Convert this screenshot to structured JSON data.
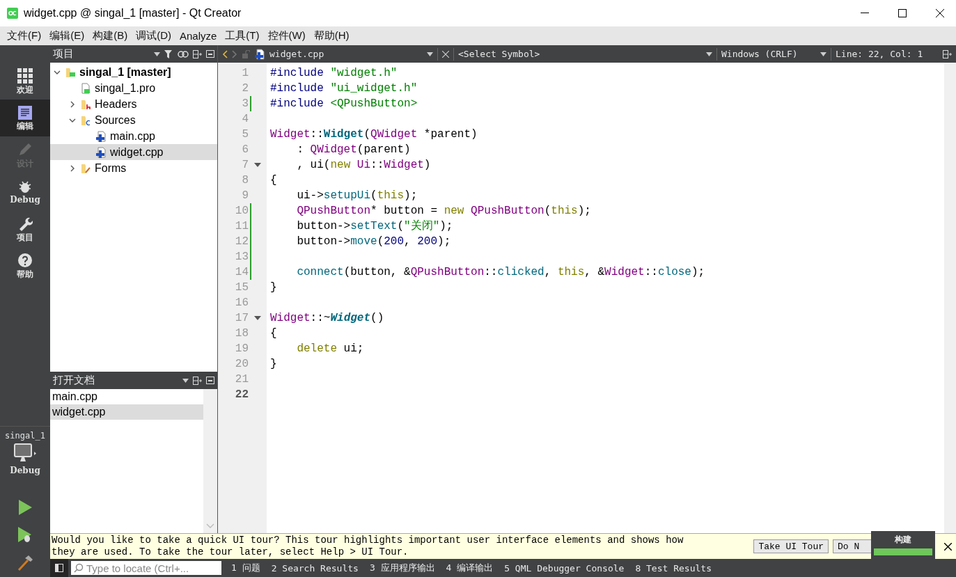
{
  "window": {
    "title": "widget.cpp @ singal_1 [master] - Qt Creator"
  },
  "menu": [
    "文件(F)",
    "编辑(E)",
    "构建(B)",
    "调试(D)",
    "Analyze",
    "工具(T)",
    "控件(W)",
    "帮助(H)"
  ],
  "modes": [
    {
      "label": "欢迎",
      "kind": "grid",
      "selected": false,
      "disabled": false
    },
    {
      "label": "编辑",
      "kind": "edit",
      "selected": true,
      "disabled": false
    },
    {
      "label": "设计",
      "kind": "pencil",
      "selected": false,
      "disabled": true
    },
    {
      "label": "Debug",
      "kind": "bug",
      "selected": false,
      "disabled": false
    },
    {
      "label": "项目",
      "kind": "wrench",
      "selected": false,
      "disabled": false
    },
    {
      "label": "帮助",
      "kind": "help",
      "selected": false,
      "disabled": false
    }
  ],
  "target": {
    "project": "singal_1",
    "config": "Debug"
  },
  "project_panel": {
    "title": "项目",
    "tree": [
      {
        "label": "singal_1 [master]",
        "kind": "project",
        "expanded": true,
        "selected": false,
        "children": [
          {
            "label": "singal_1.pro",
            "kind": "pro",
            "selected": false
          },
          {
            "label": "Headers",
            "kind": "headers",
            "expanded": false,
            "selected": false
          },
          {
            "label": "Sources",
            "kind": "sources",
            "expanded": true,
            "selected": false,
            "children": [
              {
                "label": "main.cpp",
                "kind": "cpp",
                "selected": false
              },
              {
                "label": "widget.cpp",
                "kind": "cpp",
                "selected": true
              }
            ]
          },
          {
            "label": "Forms",
            "kind": "forms",
            "expanded": false,
            "selected": false
          }
        ]
      }
    ]
  },
  "open_documents": {
    "title": "打开文档",
    "items": [
      {
        "name": "main.cpp",
        "selected": false
      },
      {
        "name": "widget.cpp",
        "selected": true
      }
    ]
  },
  "editor": {
    "file": "widget.cpp",
    "symbol": "<Select Symbol>",
    "line_ending": "Windows (CRLF)",
    "position": "Line: 22, Col: 1",
    "lines": [
      {
        "number": "1",
        "changed": false,
        "fold": false,
        "current": false,
        "tokens": [
          {
            "t": "#include",
            "kind": "pp"
          },
          {
            "t": " \"widget.h\"",
            "kind": "str"
          }
        ]
      },
      {
        "number": "2",
        "changed": false,
        "fold": false,
        "current": false,
        "tokens": [
          {
            "t": "#include",
            "kind": "pp"
          },
          {
            "t": " \"ui_widget.h\"",
            "kind": "str"
          }
        ]
      },
      {
        "number": "3",
        "changed": true,
        "fold": false,
        "current": false,
        "tokens": [
          {
            "t": "#include",
            "kind": "pp"
          },
          {
            "t": " <QPushButton>",
            "kind": "str"
          }
        ]
      },
      {
        "number": "4",
        "changed": false,
        "fold": false,
        "current": false
      },
      {
        "number": "5",
        "changed": false,
        "fold": false,
        "current": false,
        "tokens": [
          {
            "t": "Widget",
            "kind": "type"
          },
          {
            "t": "::",
            "kind": "plain"
          },
          {
            "t": "Widget",
            "kind": "decl"
          },
          {
            "t": "(",
            "kind": "plain"
          },
          {
            "t": "QWidget",
            "kind": "type"
          },
          {
            "t": " *parent)",
            "kind": "plain"
          }
        ]
      },
      {
        "number": "6",
        "changed": false,
        "fold": false,
        "current": false,
        "tokens": [
          {
            "t": "    : ",
            "kind": "plain"
          },
          {
            "t": "QWidget",
            "kind": "type"
          },
          {
            "t": "(parent)",
            "kind": "plain"
          }
        ]
      },
      {
        "number": "7",
        "changed": false,
        "fold": true,
        "current": false,
        "tokens": [
          {
            "t": "    , ui(",
            "kind": "plain"
          },
          {
            "t": "new",
            "kind": "kw"
          },
          {
            "t": " Ui",
            "kind": "type"
          },
          {
            "t": "::",
            "kind": "plain"
          },
          {
            "t": "Widget",
            "kind": "type"
          },
          {
            "t": ")",
            "kind": "plain"
          }
        ]
      },
      {
        "number": "8",
        "changed": false,
        "fold": false,
        "current": false,
        "tokens": [
          {
            "t": "{",
            "kind": "plain"
          }
        ]
      },
      {
        "number": "9",
        "changed": false,
        "fold": false,
        "current": false,
        "tokens": [
          {
            "t": "    ui->",
            "kind": "plain"
          },
          {
            "t": "setupUi",
            "kind": "fn"
          },
          {
            "t": "(",
            "kind": "plain"
          },
          {
            "t": "this",
            "kind": "kw"
          },
          {
            "t": ");",
            "kind": "plain"
          }
        ]
      },
      {
        "number": "10",
        "changed": true,
        "fold": false,
        "current": false,
        "tokens": [
          {
            "t": "    QPushButton",
            "kind": "type"
          },
          {
            "t": "* button = ",
            "kind": "plain"
          },
          {
            "t": "new",
            "kind": "kw"
          },
          {
            "t": " QPushButton",
            "kind": "type"
          },
          {
            "t": "(",
            "kind": "plain"
          },
          {
            "t": "this",
            "kind": "kw"
          },
          {
            "t": ");",
            "kind": "plain"
          }
        ]
      },
      {
        "number": "11",
        "changed": true,
        "fold": false,
        "current": false,
        "tokens": [
          {
            "t": "    button->",
            "kind": "plain"
          },
          {
            "t": "setText",
            "kind": "fn"
          },
          {
            "t": "(",
            "kind": "plain"
          },
          {
            "t": "\"关闭\"",
            "kind": "str"
          },
          {
            "t": ");",
            "kind": "plain"
          }
        ]
      },
      {
        "number": "12",
        "changed": true,
        "fold": false,
        "current": false,
        "tokens": [
          {
            "t": "    button->",
            "kind": "plain"
          },
          {
            "t": "move",
            "kind": "fn"
          },
          {
            "t": "(",
            "kind": "plain"
          },
          {
            "t": "200",
            "kind": "num"
          },
          {
            "t": ", ",
            "kind": "plain"
          },
          {
            "t": "200",
            "kind": "num"
          },
          {
            "t": ");",
            "kind": "plain"
          }
        ]
      },
      {
        "number": "13",
        "changed": true,
        "fold": false,
        "current": false
      },
      {
        "number": "14",
        "changed": true,
        "fold": false,
        "current": false,
        "tokens": [
          {
            "t": "    connect",
            "kind": "fn"
          },
          {
            "t": "(button, &",
            "kind": "plain"
          },
          {
            "t": "QPushButton",
            "kind": "type"
          },
          {
            "t": "::",
            "kind": "plain"
          },
          {
            "t": "clicked",
            "kind": "fn"
          },
          {
            "t": ", ",
            "kind": "plain"
          },
          {
            "t": "this",
            "kind": "kw"
          },
          {
            "t": ", &",
            "kind": "plain"
          },
          {
            "t": "Widget",
            "kind": "type"
          },
          {
            "t": "::",
            "kind": "plain"
          },
          {
            "t": "close",
            "kind": "fn"
          },
          {
            "t": ");",
            "kind": "plain"
          }
        ]
      },
      {
        "number": "15",
        "changed": false,
        "fold": false,
        "current": false,
        "tokens": [
          {
            "t": "}",
            "kind": "plain"
          }
        ]
      },
      {
        "number": "16",
        "changed": false,
        "fold": false,
        "current": false
      },
      {
        "number": "17",
        "changed": false,
        "fold": true,
        "current": false,
        "tokens": [
          {
            "t": "Widget",
            "kind": "type"
          },
          {
            "t": "::~",
            "kind": "plain"
          },
          {
            "t": "Widget",
            "kind": "decl-italic"
          },
          {
            "t": "()",
            "kind": "plain"
          }
        ]
      },
      {
        "number": "18",
        "changed": false,
        "fold": false,
        "current": false,
        "tokens": [
          {
            "t": "{",
            "kind": "plain"
          }
        ]
      },
      {
        "number": "19",
        "changed": false,
        "fold": false,
        "current": false,
        "tokens": [
          {
            "t": "    delete",
            "kind": "kw"
          },
          {
            "t": " ui;",
            "kind": "plain"
          }
        ]
      },
      {
        "number": "20",
        "changed": false,
        "fold": false,
        "current": false,
        "tokens": [
          {
            "t": "}",
            "kind": "plain"
          }
        ]
      },
      {
        "number": "21",
        "changed": false,
        "fold": false,
        "current": false
      },
      {
        "number": "22",
        "changed": false,
        "fold": false,
        "current": true
      }
    ]
  },
  "tour_bar": {
    "message": "Would you like to take a quick UI tour? This tour highlights important user interface elements and shows how they are used. To take the tour later, select Help > UI Tour.",
    "buttons": [
      "Take UI Tour",
      "Do N"
    ]
  },
  "build_popup": {
    "title": "构建",
    "level": 1
  },
  "status_bar": {
    "locator": {
      "placeholder": "Type to locate (Ctrl+..."
    },
    "panes": [
      "1 问题",
      "2 Search Results",
      "3 应用程序输出",
      "4 编译输出",
      "5 QML Debugger Console",
      "8 Test Results"
    ]
  }
}
